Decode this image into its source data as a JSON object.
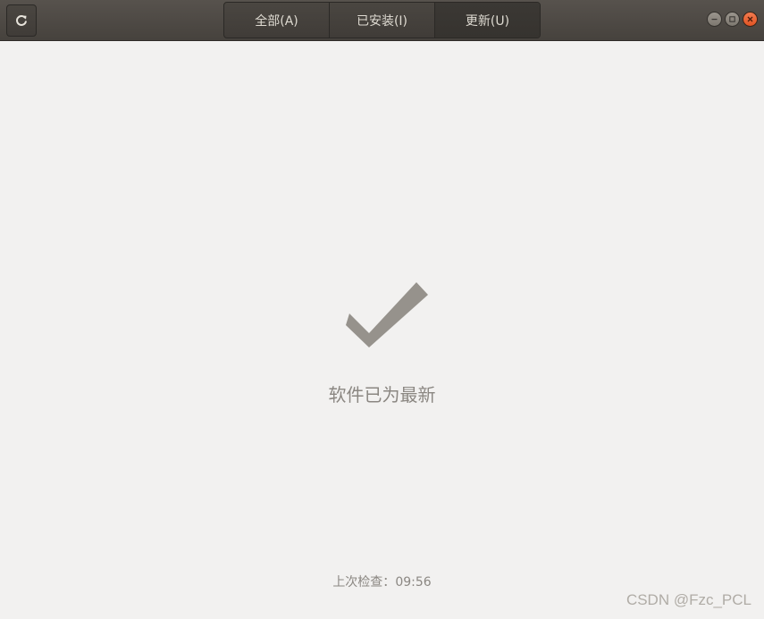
{
  "header": {
    "tabs": [
      {
        "label": "全部(A)"
      },
      {
        "label": "已安装(I)"
      },
      {
        "label": "更新(U)"
      }
    ]
  },
  "main": {
    "status": "软件已为最新",
    "last_check_label": "上次检查：",
    "last_check_time": "09:56"
  },
  "watermark": "CSDN @Fzc_PCL",
  "colors": {
    "headerbar": "#4a4641",
    "background": "#f2f1f0",
    "checkmark": "#96928c",
    "close_button": "#e95420"
  },
  "icons": {
    "refresh": "refresh-icon",
    "check": "checkmark-icon",
    "minimize": "minimize-icon",
    "maximize": "maximize-icon",
    "close": "close-icon"
  }
}
